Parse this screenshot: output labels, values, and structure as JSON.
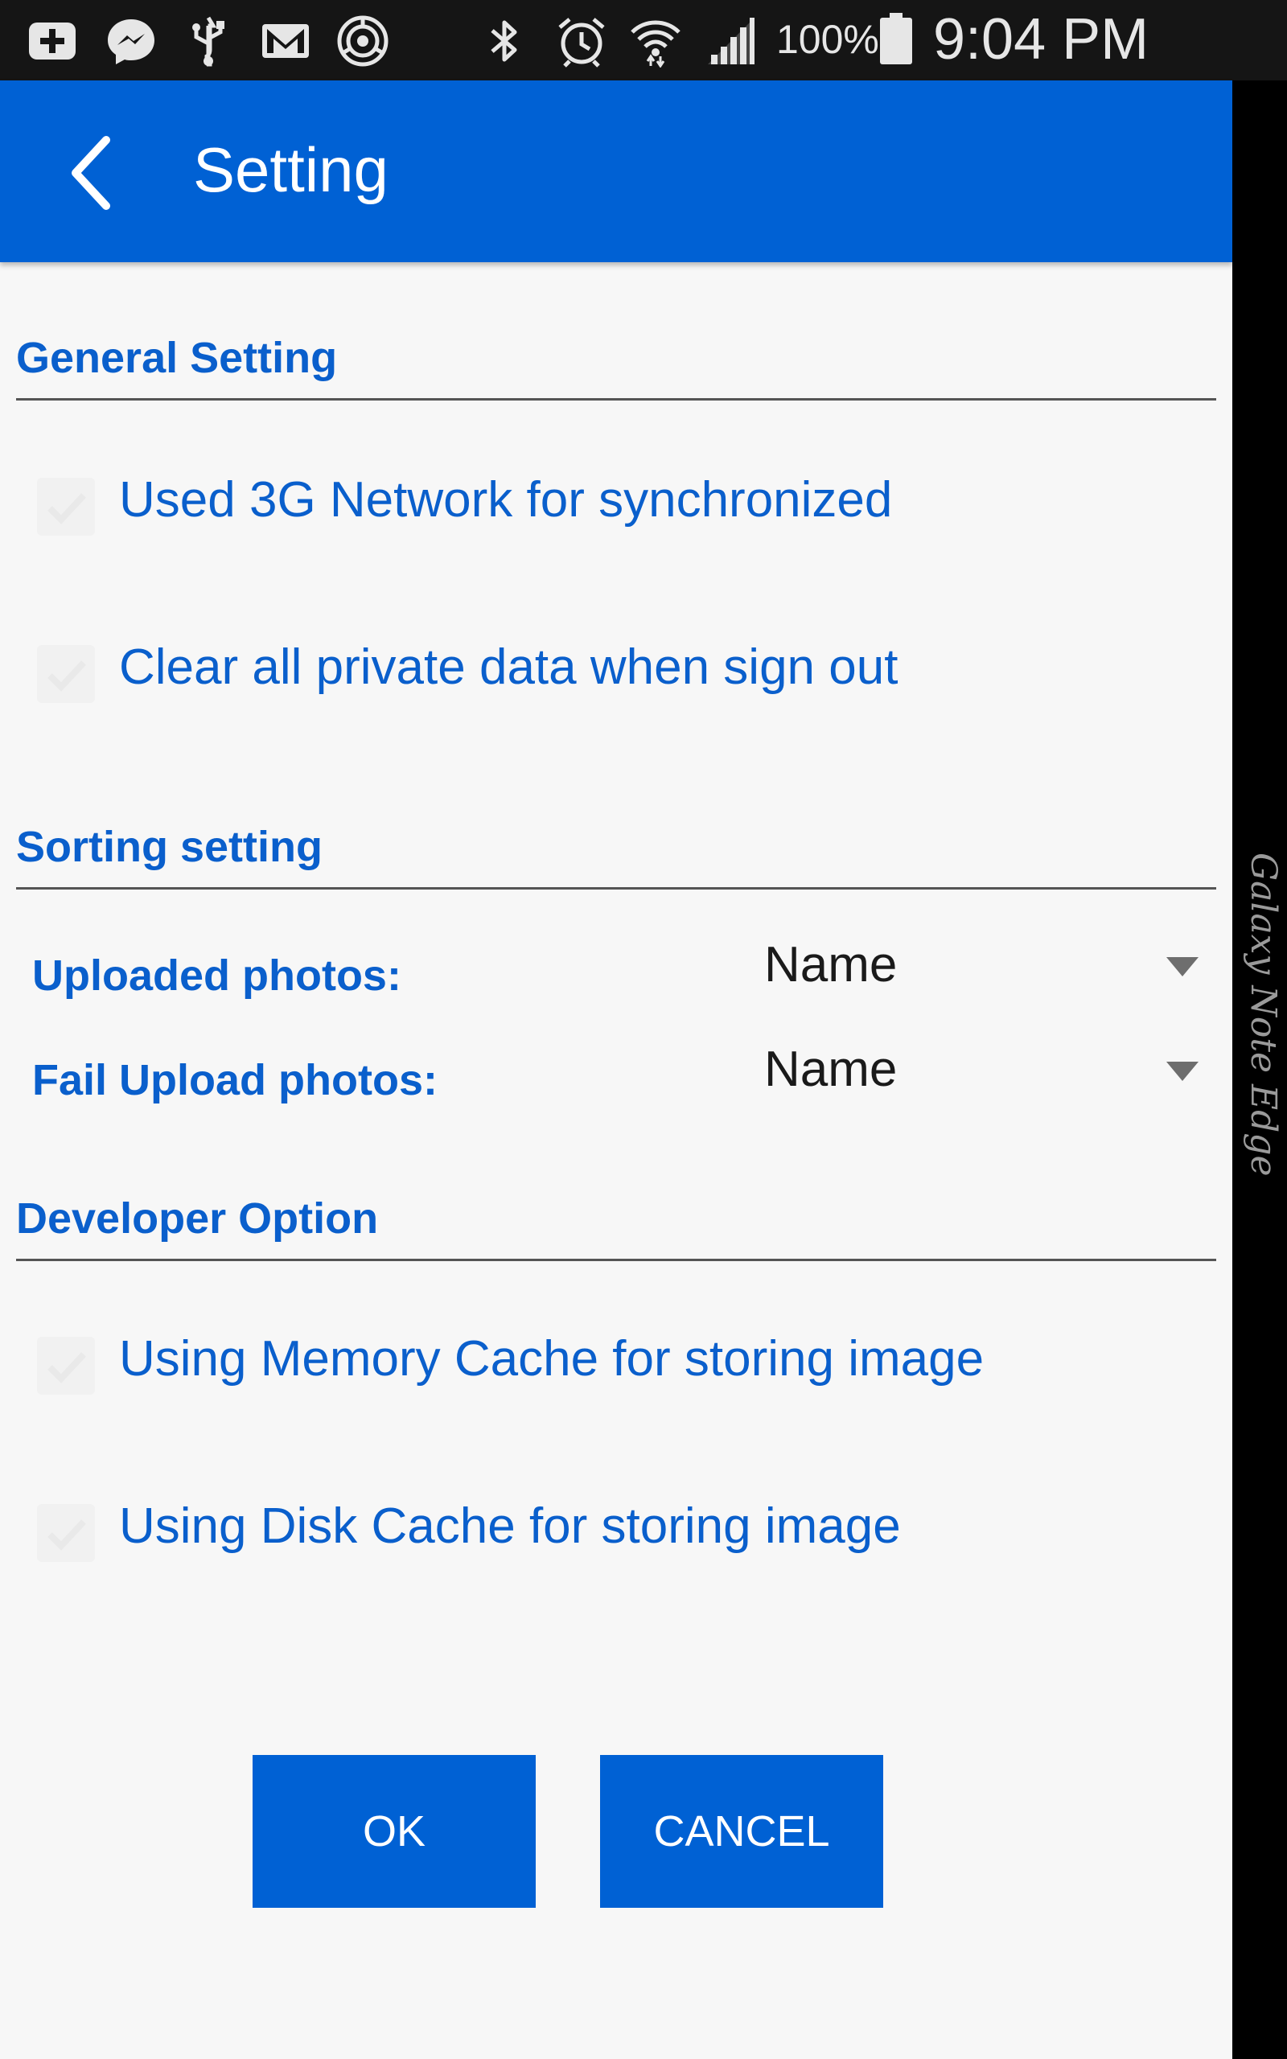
{
  "status_bar": {
    "battery": "100%",
    "time": "9:04 PM",
    "icons": [
      "add-icon",
      "messenger-icon",
      "usb-icon",
      "gmail-icon",
      "browser-icon",
      "bluetooth-icon",
      "alarm-icon",
      "wifi-icon",
      "signal-icon",
      "battery-icon"
    ]
  },
  "edge_label": "Galaxy Note Edge",
  "app_bar": {
    "title": "Setting",
    "back_icon": "chevron-left-icon",
    "color": "#0061d4"
  },
  "sections": {
    "general": {
      "title": "General Setting",
      "options": [
        {
          "label": "Used 3G Network for synchronized",
          "checked": true
        },
        {
          "label": "Clear all private data when sign out",
          "checked": true
        }
      ]
    },
    "sorting": {
      "title": "Sorting setting",
      "rows": [
        {
          "label": "Uploaded photos:",
          "value": "Name"
        },
        {
          "label": "Fail Upload photos:",
          "value": "Name"
        }
      ]
    },
    "developer": {
      "title": "Developer Option",
      "options": [
        {
          "label": "Using Memory Cache for storing image",
          "checked": true
        },
        {
          "label": "Using Disk Cache for storing image",
          "checked": true
        }
      ]
    }
  },
  "buttons": {
    "ok": "OK",
    "cancel": "CANCEL"
  },
  "colors": {
    "accent": "#0a5fcc",
    "background": "#f7f7f7"
  }
}
